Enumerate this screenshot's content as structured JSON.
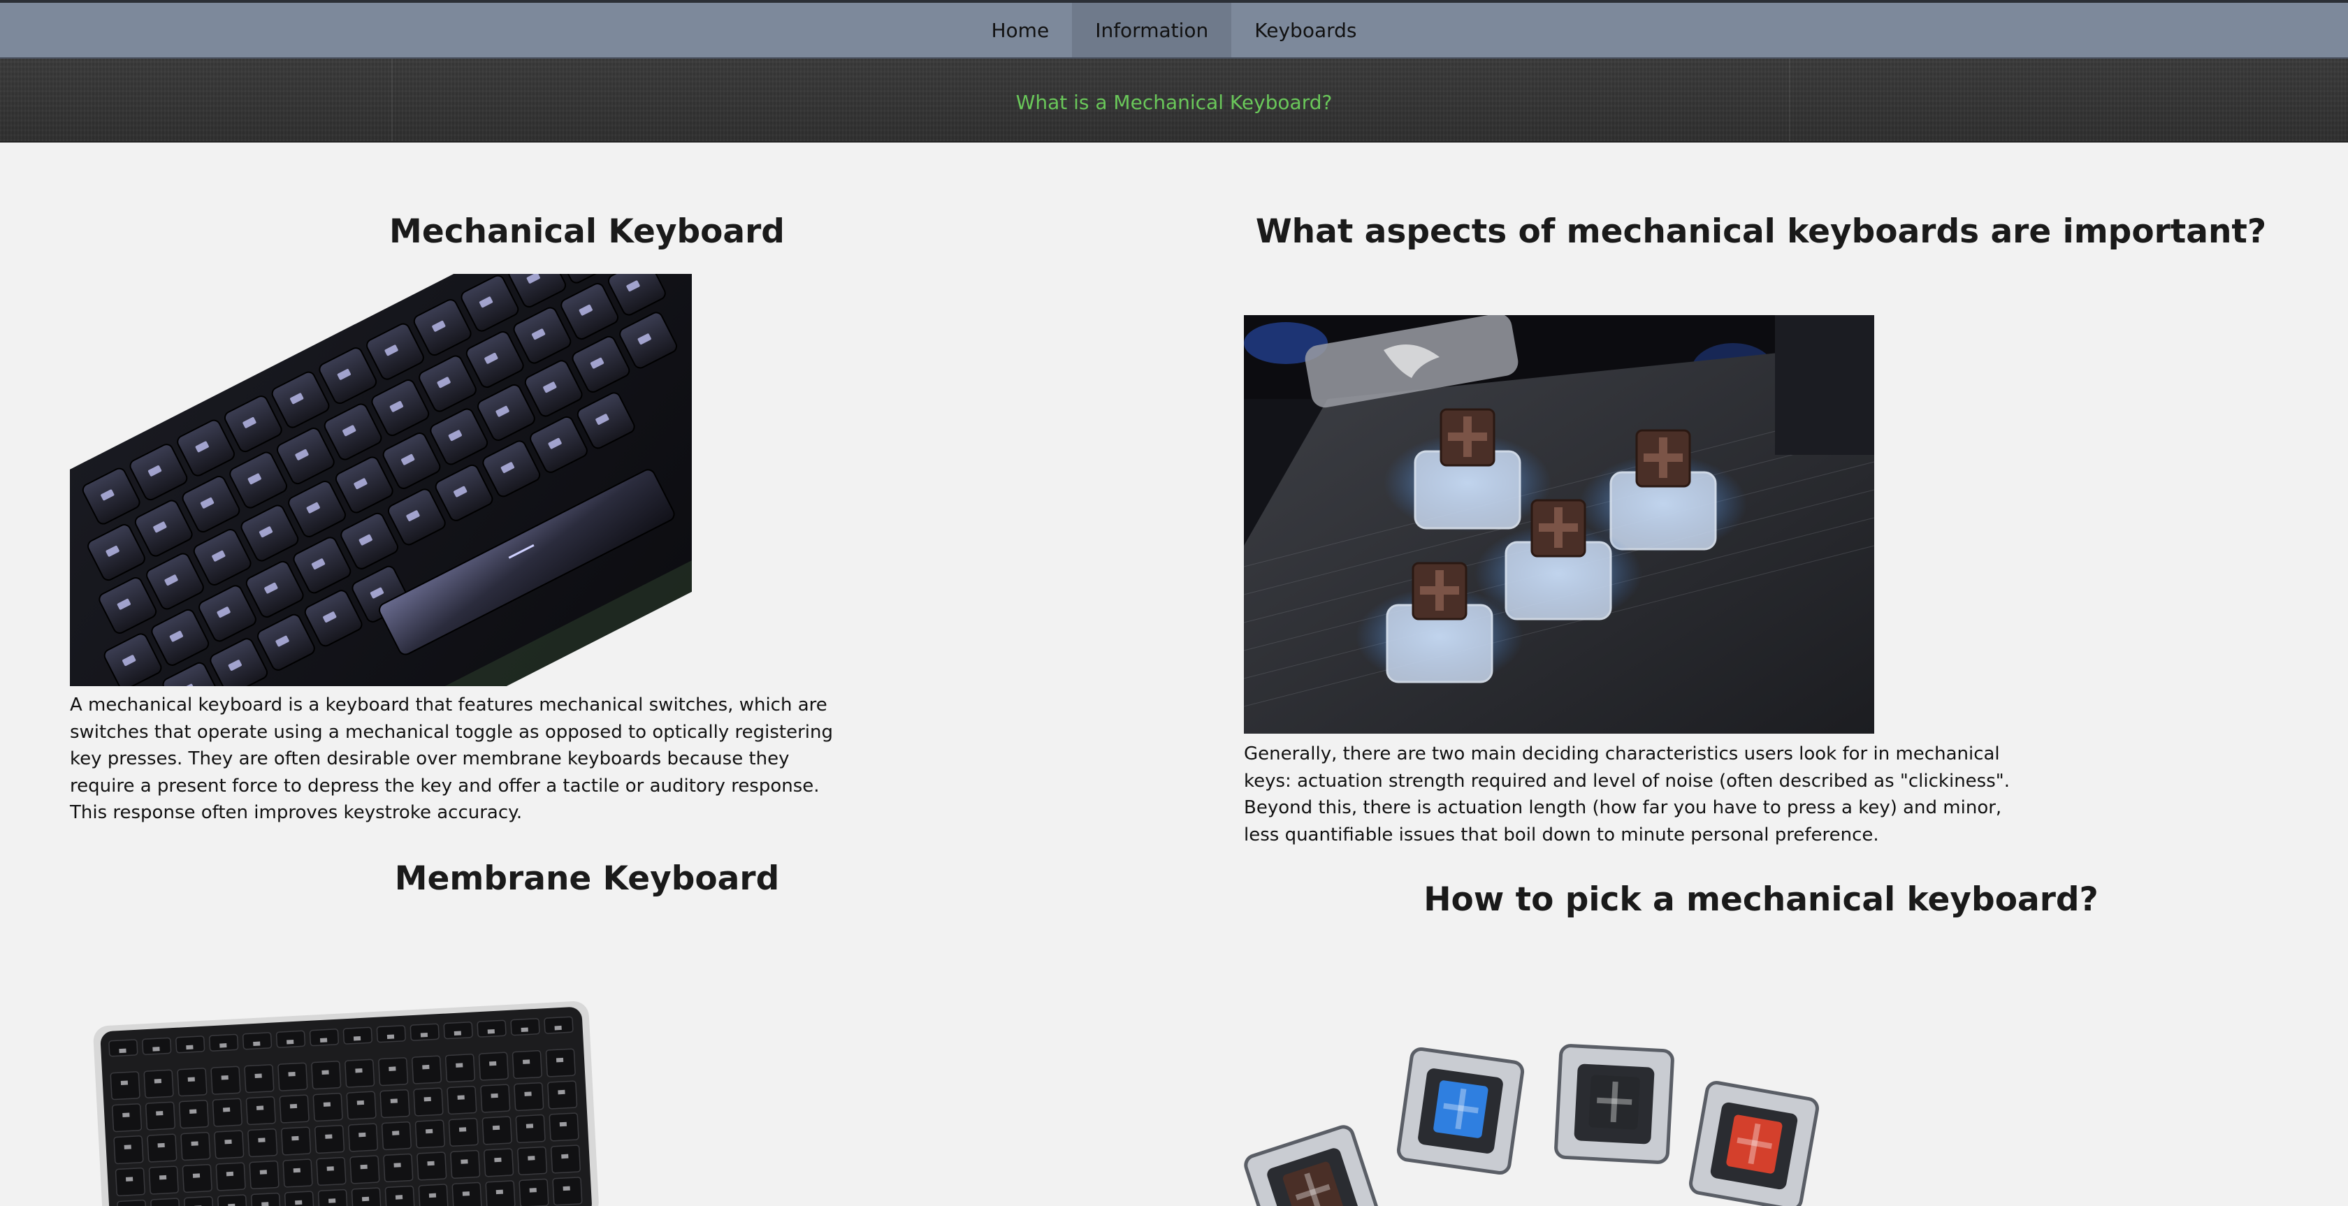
{
  "nav": {
    "items": [
      {
        "label": "Home"
      },
      {
        "label": "Information"
      },
      {
        "label": "Keyboards"
      }
    ],
    "active_index": 1
  },
  "subnav": {
    "link": "What is a Mechanical Keyboard?"
  },
  "left": {
    "heading1": "Mechanical Keyboard",
    "paragraph1": "A mechanical keyboard is a keyboard that features mechanical switches, which are switches that operate using a mechanical toggle as opposed to optically registering key presses. They are often desirable over membrane keyboards because they require a present force to depress the key and offer a tactile or auditory response. This response often improves keystroke accuracy.",
    "heading2": "Membrane Keyboard"
  },
  "right": {
    "heading1": "What aspects of mechanical keyboards are important?",
    "paragraph1": "Generally, there are two main deciding characteristics users look for in mechanical keys: actuation strength required and level of noise (often described as \"clickiness\". Beyond this, there is actuation length (how far you have to press a key) and minor, less quantifiable issues that boil down to minute personal preference.",
    "heading2": "How to pick a mechanical keyboard?"
  },
  "images": {
    "mechanical": "mechanical-keyboard-photo",
    "switches": "keyboard-switches-photo",
    "membrane": "membrane-keyboard-photo",
    "switch_samples": "switch-samples-photo"
  },
  "colors": {
    "nav_bg": "#7d899b",
    "nav_active": "#6f7a8b",
    "subbar_bg": "#333333",
    "link_green": "#6ac85a",
    "page_bg": "#f2f2f2"
  }
}
